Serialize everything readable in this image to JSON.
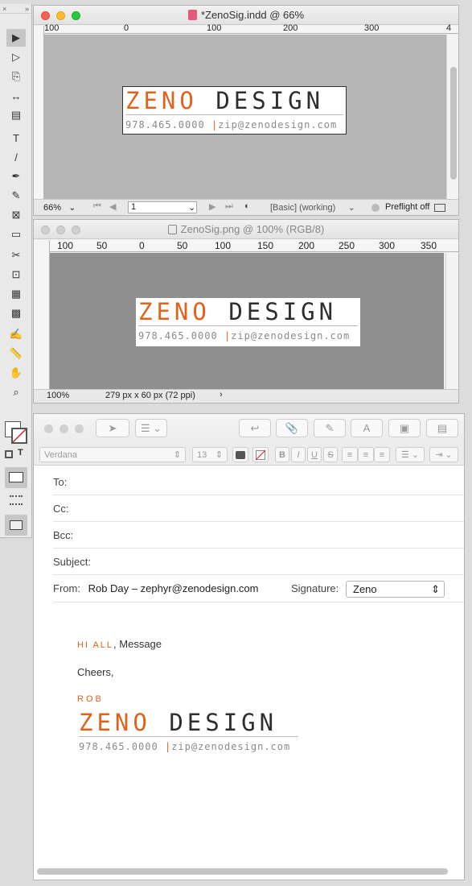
{
  "tools": {
    "close": "×",
    "collapse": "»",
    "items": [
      "▶",
      "▷",
      "⎘",
      "↔",
      "▤",
      "T",
      "/",
      "✒",
      "✎",
      "⊠",
      "▭",
      "✂",
      "⊡",
      "▦",
      "▩",
      "✍",
      "📏",
      "✋",
      "⌕"
    ]
  },
  "indd": {
    "title": "*ZenoSig.indd @ 66%",
    "ruler": [
      "100",
      "0",
      "100",
      "200",
      "300",
      "4"
    ],
    "zoom": "66%",
    "page": "1",
    "mode": "[Basic] (working)",
    "preflight": "Preflight off"
  },
  "png": {
    "title": "ZenoSig.png @ 100% (RGB/8)",
    "ruler": [
      "100",
      "50",
      "0",
      "50",
      "100",
      "150",
      "200",
      "250",
      "300",
      "350"
    ],
    "zoom": "100%",
    "size": "279 px x 60 px (72 ppi)"
  },
  "signature": {
    "word1": "ZENO",
    "word2": "DESIGN",
    "phone": "978.465.0000",
    "sep": "|",
    "email": "zip@zenodesign.com"
  },
  "mail": {
    "font": "Verdana",
    "size": "13",
    "to_label": "To:",
    "cc_label": "Cc:",
    "bcc_label": "Bcc:",
    "subject_label": "Subject:",
    "from_label": "From:",
    "from_value": "Rob Day – zephyr@zenodesign.com",
    "signature_label": "Signature:",
    "signature_value": "Zeno",
    "greeting_hi": "HI ALL",
    "greeting_rest": ", Message",
    "cheers": "Cheers,",
    "name": "ROB"
  },
  "colors": {
    "accent": "#e0621c",
    "dark": "#2e2e2e",
    "grey": "#8a8a8a"
  }
}
